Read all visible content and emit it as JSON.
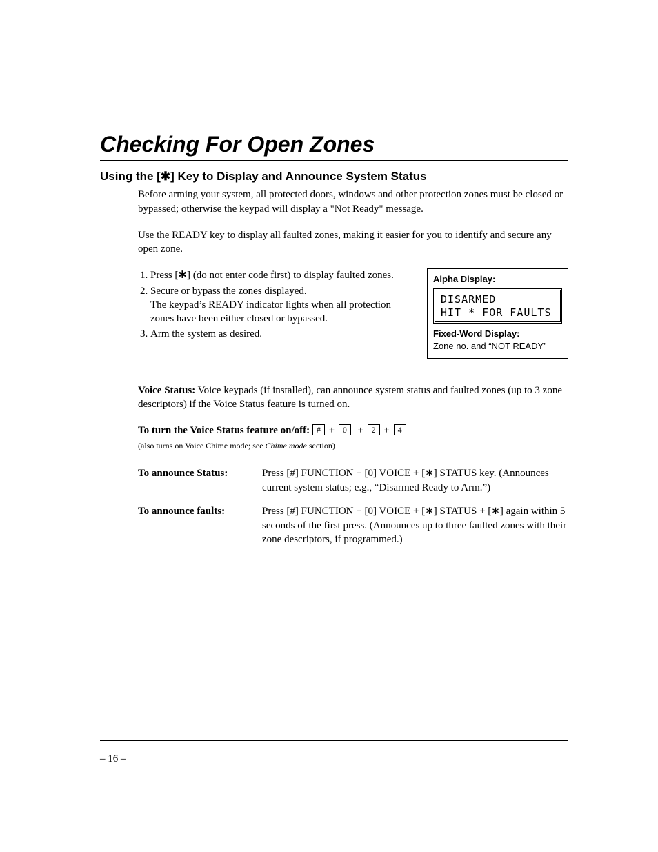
{
  "title": "Checking For Open Zones",
  "subtitle": "Using the [✱] Key to Display and Announce System Status",
  "intro_para": "Before arming your system, all protected doors, windows and other protection zones must be closed or bypassed; otherwise the keypad will display a \"Not Ready\" message.",
  "ready_para": "Use the READY key to display all faulted zones, making it easier for you to identify and secure any open zone.",
  "steps": {
    "s1": "Press [✱] (do not enter code first) to display faulted zones.",
    "s2a": "Secure or bypass the zones displayed.",
    "s2b": "The keypad’s READY indicator lights when all protection zones have been either closed or bypassed.",
    "s3": "Arm the system as desired."
  },
  "display": {
    "alpha_label": "Alpha Display:",
    "lcd_line1": "DISARMED",
    "lcd_line2": "HIT * FOR FAULTS",
    "fixed_title": "Fixed-Word Display:",
    "fixed_text": "Zone no. and “NOT READY”"
  },
  "voice_status": {
    "label": "Voice Status:",
    "text": " Voice keypads (if installed), can announce system status and faulted zones (up to 3 zone descriptors) if the Voice Status feature is turned on."
  },
  "voice_toggle": {
    "label": "To turn the Voice Status feature on/off: ",
    "keys": {
      "k1": "#",
      "k2": "0",
      "k3": "2",
      "k4": "4"
    },
    "note_a": "(also turns on Voice Chime mode; see ",
    "note_b": "Chime mode",
    "note_c": " section)"
  },
  "announce_status": {
    "label": "To announce Status:",
    "text": "Press [#] FUNCTION + [0] VOICE + [∗] STATUS key. (Announces current system status; e.g., “Disarmed Ready to Arm.”)"
  },
  "announce_faults": {
    "label": "To announce faults:",
    "text": "Press [#] FUNCTION + [0] VOICE + [∗] STATUS + [∗] again within 5 seconds of the first press. (Announces up to three faulted zones with their zone descriptors, if programmed.)"
  },
  "page_number": "– 16 –"
}
